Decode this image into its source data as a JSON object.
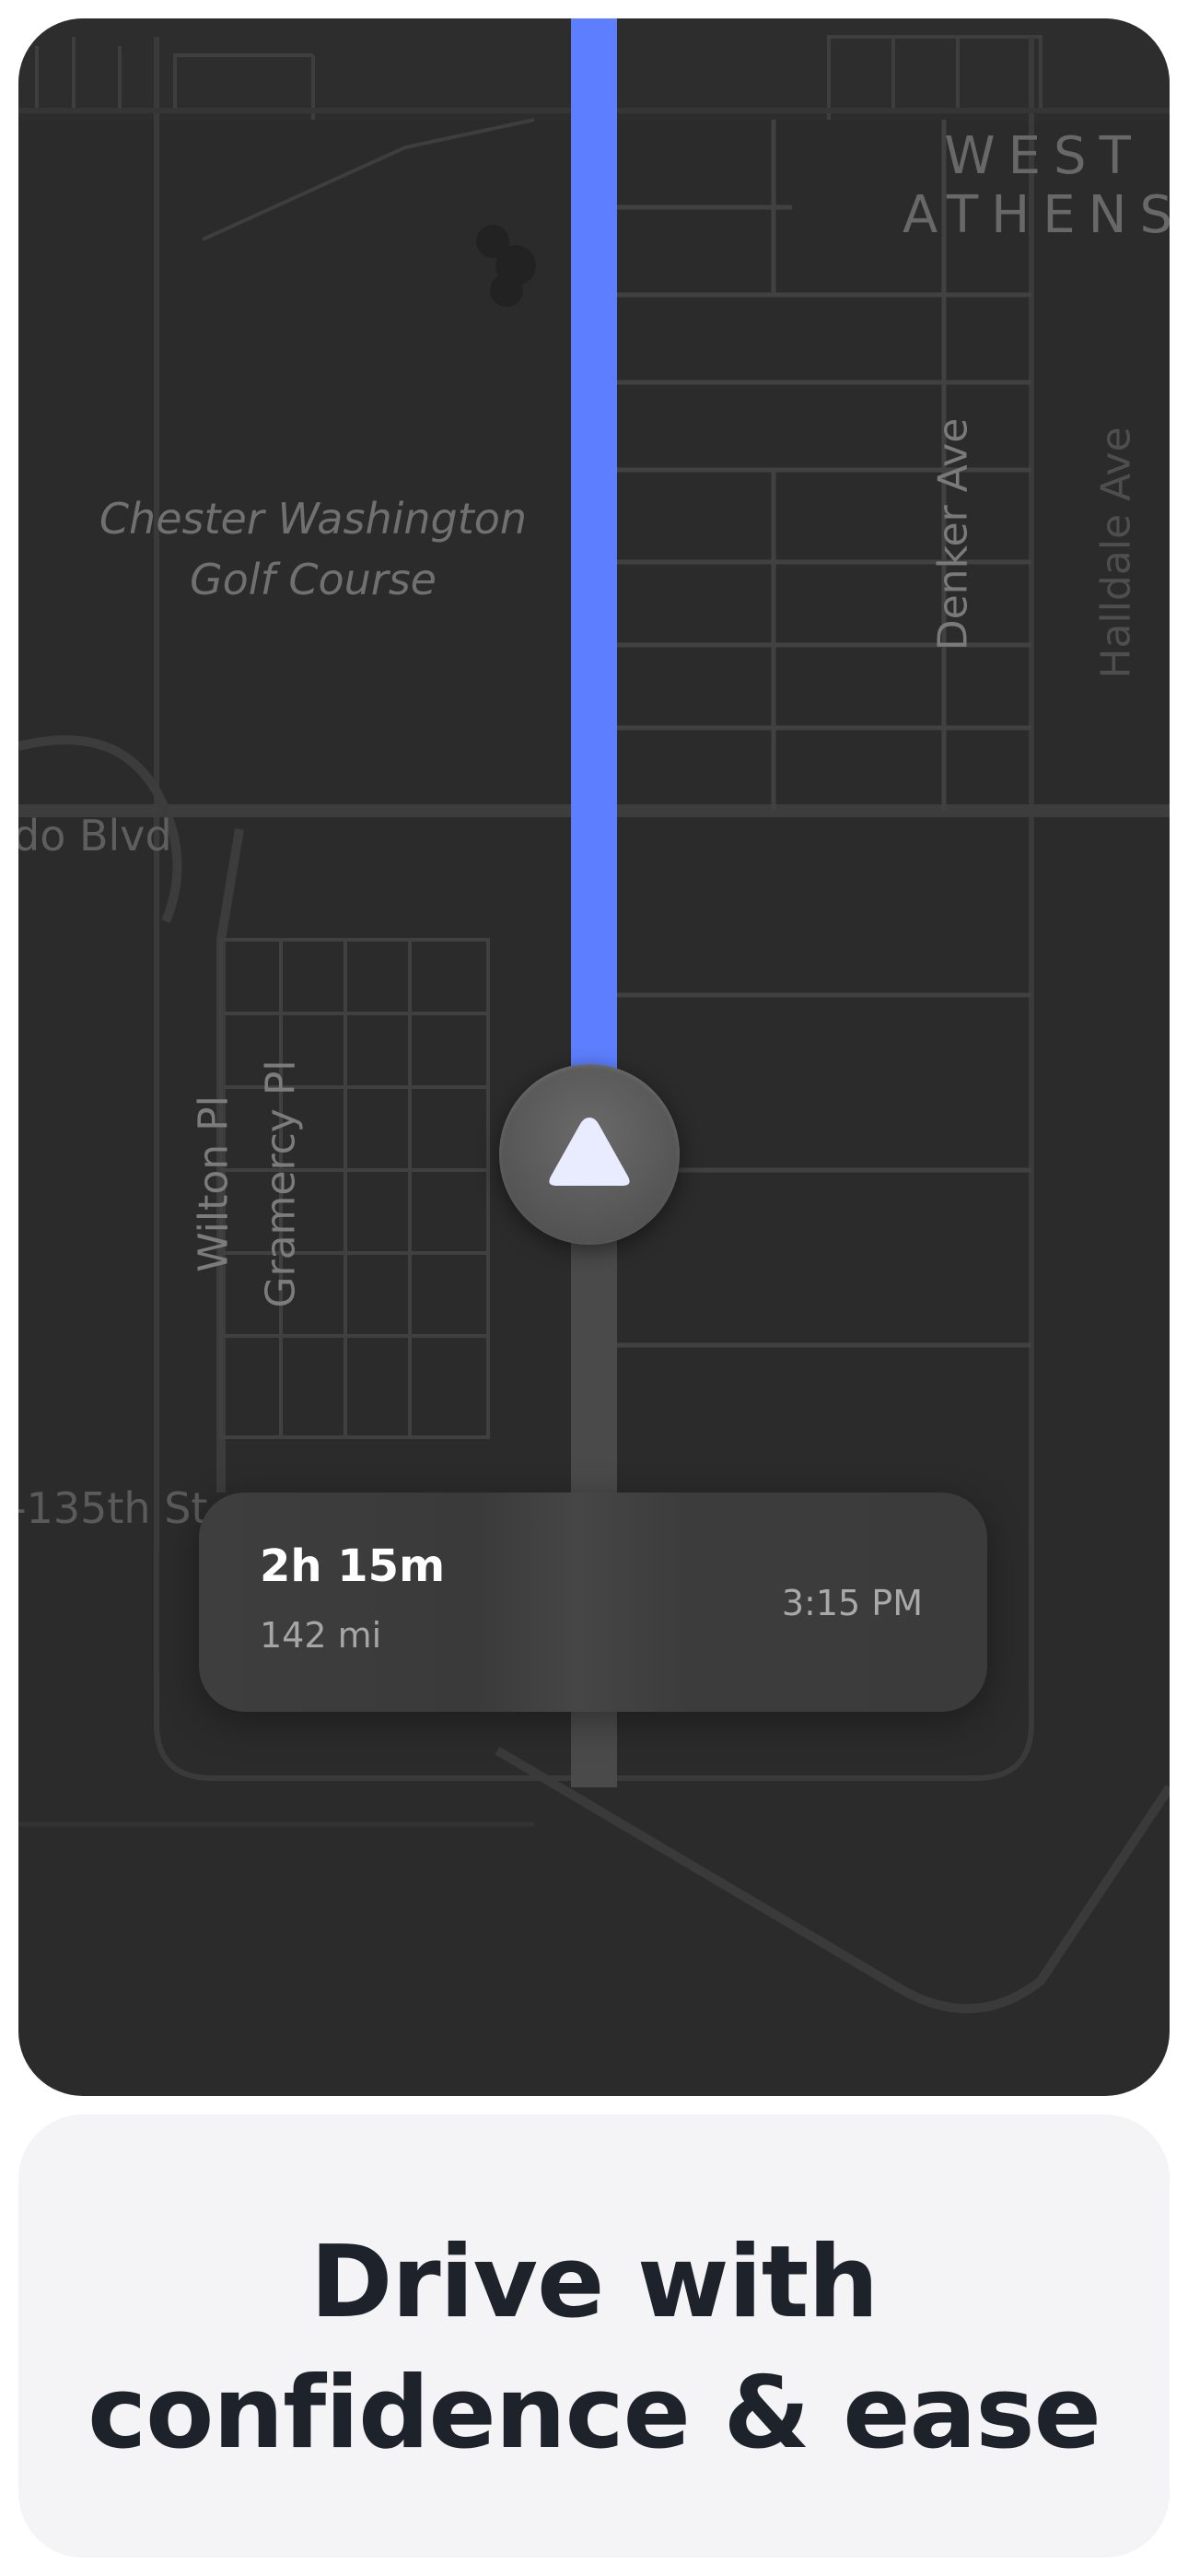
{
  "map": {
    "labels": {
      "golf_line1": "Chester Washington",
      "golf_line2": "Golf Course",
      "area_line1": "WEST",
      "area_line2": "ATHENS",
      "street_denker": "Denker Ave",
      "street_halldale": "Halldale Ave",
      "street_wilton": "Wilton Pl",
      "street_gramercy": "Gramercy Pl",
      "street_blvd": "do Blvd",
      "street_135th": "-135th St"
    },
    "route_color": "#5d7fff",
    "background_color": "#2b2b2b"
  },
  "navigation": {
    "icon": "navigation-arrow-icon"
  },
  "trip": {
    "duration": "2h 15m",
    "distance": "142 mi",
    "eta": "3:15 PM"
  },
  "caption": {
    "line1": "Drive with",
    "line2": "confidence & ease"
  }
}
